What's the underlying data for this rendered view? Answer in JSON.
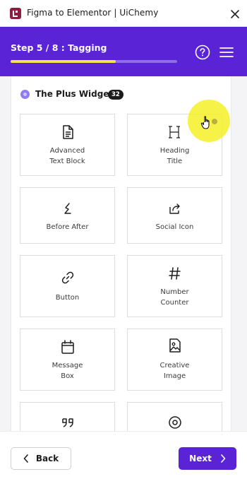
{
  "window": {
    "title": "Figma to Elementor | UiChemy",
    "logo_icon": "uichemy-logo-icon",
    "close_icon": "close-icon"
  },
  "step": {
    "label": "Step 5 / 8 : Tagging",
    "progress": 0.63
  },
  "header_icons": {
    "help": "help-circle-icon",
    "menu": "hamburger-menu-icon"
  },
  "section": {
    "title": "The Plus Widgets",
    "count": "32"
  },
  "widgets": [
    {
      "lines": [
        "Advanced",
        "Text Block"
      ],
      "icon": "document-text-icon"
    },
    {
      "lines": [
        "Heading",
        "Title"
      ],
      "icon": "heading-h-icon"
    },
    {
      "lines": [
        "Before After"
      ],
      "icon": "before-after-icon"
    },
    {
      "lines": [
        "Social Icon"
      ],
      "icon": "share-icon"
    },
    {
      "lines": [
        "Button"
      ],
      "icon": "link-icon"
    },
    {
      "lines": [
        "Number",
        "Counter"
      ],
      "icon": "hash-icon"
    },
    {
      "lines": [
        "Message",
        "Box"
      ],
      "icon": "calendar-icon"
    },
    {
      "lines": [
        "Creative",
        "Image"
      ],
      "icon": "image-icon"
    },
    {
      "lines": [],
      "icon": "quote-icon"
    },
    {
      "lines": [],
      "icon": "radio-circle-icon"
    }
  ],
  "footer": {
    "back_label": "Back",
    "next_label": "Next"
  },
  "colors": {
    "brand": "#5a24d6",
    "progress": "#f6e04d",
    "logo": "#8b1d41"
  }
}
